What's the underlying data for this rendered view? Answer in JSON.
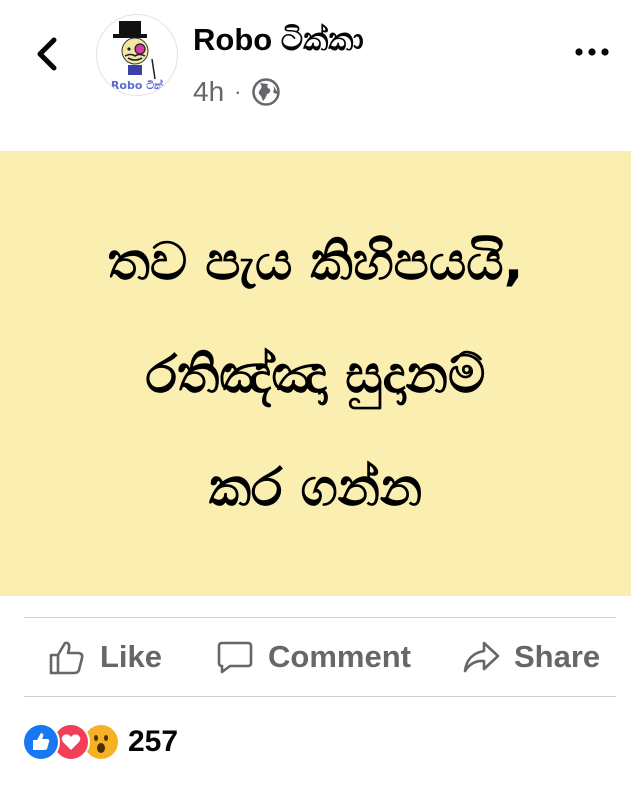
{
  "header": {
    "page_name": "Robo ටික්කා",
    "avatar_caption": "Robo ටික්",
    "time": "4h",
    "separator": "·"
  },
  "post": {
    "lines": [
      "තව පැය කිහිපයයි,",
      "රතිඤ්ඤා සුදානම්",
      "කර ගන්න"
    ],
    "background_color": "#faeeb0"
  },
  "actions": {
    "like": "Like",
    "comment": "Comment",
    "share": "Share"
  },
  "reactions": {
    "count": "257",
    "types": [
      "like-icon",
      "love-icon",
      "wow-icon"
    ]
  }
}
